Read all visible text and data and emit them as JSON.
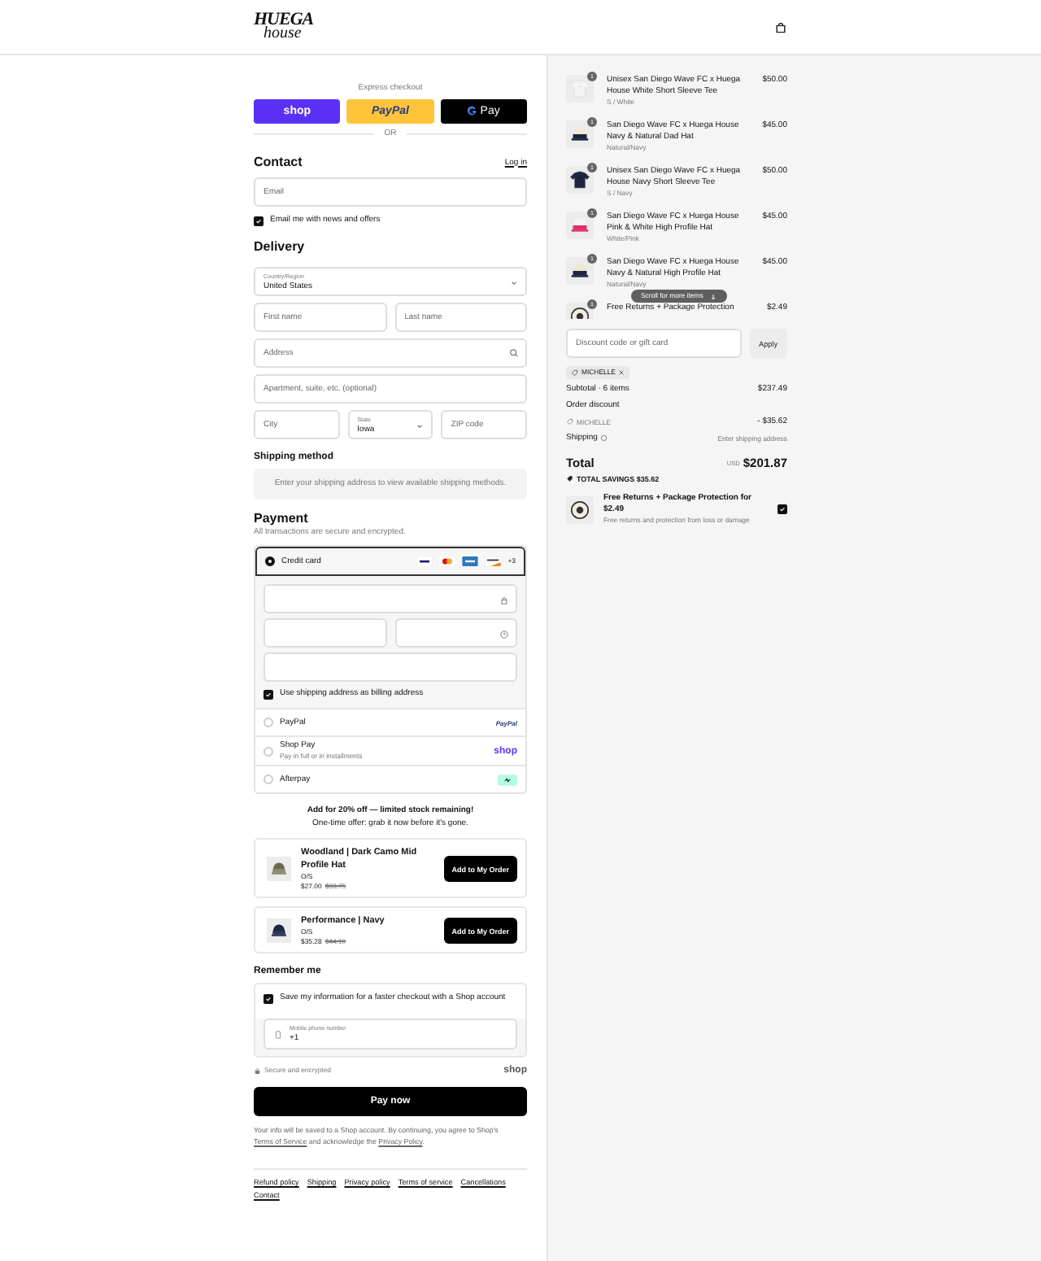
{
  "header": {
    "logo_top": "HUEGA",
    "logo_bottom": "house"
  },
  "express": {
    "label": "Express checkout",
    "buttons": [
      {
        "kind": "shop",
        "label": "shop"
      },
      {
        "kind": "paypal",
        "label": "PayPal"
      },
      {
        "kind": "gpay",
        "label": "Pay"
      }
    ],
    "separator": "OR"
  },
  "contact": {
    "title": "Contact",
    "login": "Log in",
    "email_placeholder": "Email",
    "newsletter": {
      "label": "Email me with news and offers",
      "checked": true
    }
  },
  "delivery": {
    "title": "Delivery",
    "country": {
      "label": "Country/Region",
      "value": "United States"
    },
    "first_name_placeholder": "First name",
    "last_name_placeholder": "Last name",
    "address_placeholder": "Address",
    "apartment_placeholder": "Apartment, suite, etc. (optional)",
    "city_placeholder": "City",
    "state": {
      "label": "State",
      "value": "Iowa"
    },
    "zip_placeholder": "ZIP code"
  },
  "shipping": {
    "title": "Shipping method",
    "message": "Enter your shipping address to view available shipping methods."
  },
  "payment": {
    "title": "Payment",
    "subtitle": "All transactions are secure and encrypted.",
    "more_cards": "+3",
    "billing": {
      "label": "Use shipping address as billing address",
      "checked": true
    },
    "methods": [
      {
        "kind": "card",
        "label": "Credit card",
        "selected": true
      },
      {
        "kind": "paypal",
        "label": "PayPal",
        "logo": "PayPal",
        "selected": false
      },
      {
        "kind": "shoppay",
        "label": "Shop Pay",
        "note": "Pay in full or in installments",
        "logo": "shop",
        "selected": false
      },
      {
        "kind": "afterpay",
        "label": "Afterpay",
        "selected": false
      }
    ]
  },
  "offer": {
    "title": "Add for 20% off — limited stock remaining!",
    "subtitle": "One-time offer: grab it now before it's gone."
  },
  "upsells": [
    {
      "name": "Woodland | Dark Camo Mid Profile Hat",
      "variant": "O/S",
      "price": "$27.00",
      "compare_price": "$33.75",
      "button": "Add to My Order"
    },
    {
      "name": "Performance | Navy",
      "variant": "O/S",
      "price": "$35.28",
      "compare_price": "$44.10",
      "button": "Add to My Order"
    }
  ],
  "remember": {
    "title": "Remember me",
    "save": {
      "label": "Save my information for a faster checkout with a Shop account",
      "checked": true
    },
    "phone": {
      "label": "Mobile phone number",
      "value": "+1"
    }
  },
  "secure": "Secure and encrypted",
  "shop_logo": "shop",
  "pay_button": "Pay now",
  "disclaimer": {
    "text_1": "Your info will be saved to a Shop account. By continuing, you agree to Shop's",
    "link_1": "Terms of Service",
    "text_2": "and acknowledge the",
    "link_2": "Privacy Policy",
    "text_3": "."
  },
  "footer_links": [
    "Refund policy",
    "Shipping",
    "Privacy policy",
    "Terms of service",
    "Cancellations",
    "Contact"
  ],
  "cart": {
    "items": [
      {
        "quantity": "1",
        "name": "Unisex San Diego Wave FC x Huega House White Short Sleeve Tee",
        "variant": "S / White",
        "price": "$50.00"
      },
      {
        "quantity": "1",
        "name": "San Diego Wave FC x Huega House Navy & Natural Dad Hat",
        "variant": "Natural/Navy",
        "price": "$45.00"
      },
      {
        "quantity": "1",
        "name": "Unisex San Diego Wave FC x Huega House Navy Short Sleeve Tee",
        "variant": "S / Navy",
        "price": "$50.00"
      },
      {
        "quantity": "1",
        "name": "San Diego Wave FC x Huega House Pink & White High Profile Hat",
        "variant": "White/Pink",
        "price": "$45.00"
      },
      {
        "quantity": "1",
        "name": "San Diego Wave FC x Huega House Navy & Natural High Profile Hat",
        "variant": "Natural/Navy",
        "price": "$45.00"
      },
      {
        "quantity": "1",
        "name": "Free Returns + Package Protection",
        "price": "$2.49"
      }
    ],
    "scroll_hint": "Scroll for more items",
    "discount_placeholder": "Discount code or gift card",
    "apply": "Apply",
    "code": "MICHELLE",
    "subtotal_label": "Subtotal · 6 items",
    "subtotal": "$237.49",
    "discount_label": "Order discount",
    "discount_code": "MICHELLE",
    "discount_amount": "- $35.62",
    "shipping_label": "Shipping",
    "shipping_value": "Enter shipping address",
    "total_label": "Total",
    "currency": "USD",
    "total": "$201.87",
    "savings": "TOTAL SAVINGS $35.62",
    "protection": {
      "title": "Free Returns + Package Protection for $2.49",
      "subtitle": "Free returns and protection from loss or damage",
      "checked": true
    }
  }
}
